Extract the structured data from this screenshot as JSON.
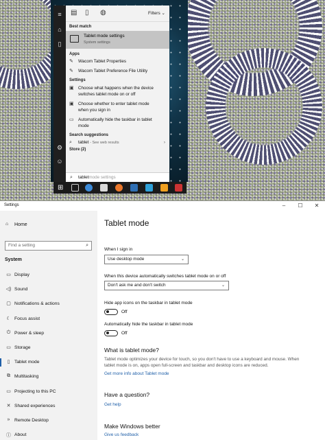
{
  "search_panel": {
    "filters_label": "Filters",
    "best_match_header": "Best match",
    "best_match": {
      "title": "Tablet mode settings",
      "subtitle": "System settings"
    },
    "apps_header": "Apps",
    "apps": [
      {
        "label": "Wacom Tablet Properties"
      },
      {
        "label": "Wacom Tablet Preference File Utility"
      }
    ],
    "settings_header": "Settings",
    "settings": [
      {
        "line1": "Choose what happens when the device",
        "line2": "switches tablet mode on or off"
      },
      {
        "line1": "Choose whether to enter tablet mode",
        "line2": "when you sign in"
      },
      {
        "line1": "Automatically hide the taskbar in tablet",
        "line2": "mode"
      }
    ],
    "suggestions_header": "Search suggestions",
    "suggestion": {
      "term": "tablet",
      "hint": "- See web results"
    },
    "store_header": "Store (2)",
    "search_box": {
      "typed": "tablet",
      "ghost": "mode settings"
    }
  },
  "settings_window": {
    "title": "Settings",
    "sidebar": {
      "home": "Home",
      "search_placeholder": "Find a setting",
      "section": "System",
      "items": [
        {
          "label": "Display",
          "icon": "monitor-icon",
          "glyph": "▭"
        },
        {
          "label": "Sound",
          "icon": "speaker-icon",
          "glyph": "◁)"
        },
        {
          "label": "Notifications & actions",
          "icon": "notification-icon",
          "glyph": "▢"
        },
        {
          "label": "Focus assist",
          "icon": "moon-icon",
          "glyph": "☾"
        },
        {
          "label": "Power & sleep",
          "icon": "power-icon",
          "glyph": "⏻"
        },
        {
          "label": "Storage",
          "icon": "storage-icon",
          "glyph": "▭"
        },
        {
          "label": "Tablet mode",
          "icon": "tablet-icon",
          "glyph": "▯",
          "active": true
        },
        {
          "label": "Multitasking",
          "icon": "multitasking-icon",
          "glyph": "⧉"
        },
        {
          "label": "Projecting to this PC",
          "icon": "projector-icon",
          "glyph": "▭"
        },
        {
          "label": "Shared experiences",
          "icon": "shared-icon",
          "glyph": "✕"
        },
        {
          "label": "Remote Desktop",
          "icon": "remote-desktop-icon",
          "glyph": "»"
        },
        {
          "label": "About",
          "icon": "info-icon",
          "glyph": "ⓘ"
        }
      ]
    },
    "content": {
      "title": "Tablet mode",
      "sign_in_label": "When I sign in",
      "sign_in_value": "Use desktop mode",
      "switch_label": "When this device automatically switches tablet mode on or off",
      "switch_value": "Don't ask me and don't switch",
      "hide_icons_label": "Hide app icons on the taskbar in tablet mode",
      "hide_icons_state": "Off",
      "hide_taskbar_label": "Automatically hide the taskbar in tablet mode",
      "hide_taskbar_state": "Off",
      "what_is_heading": "What is tablet mode?",
      "what_is_line1": "Tablet mode optimizes your device for touch, so you don't have to use a keyboard and mouse. When",
      "what_is_line2": "tablet mode is on, apps open full-screen and taskbar and desktop icons are reduced.",
      "more_info_link": "Get more info about Tablet mode",
      "question_heading": "Have a question?",
      "help_link": "Get help",
      "better_heading": "Make Windows better",
      "feedback_link": "Give us feedback"
    }
  }
}
